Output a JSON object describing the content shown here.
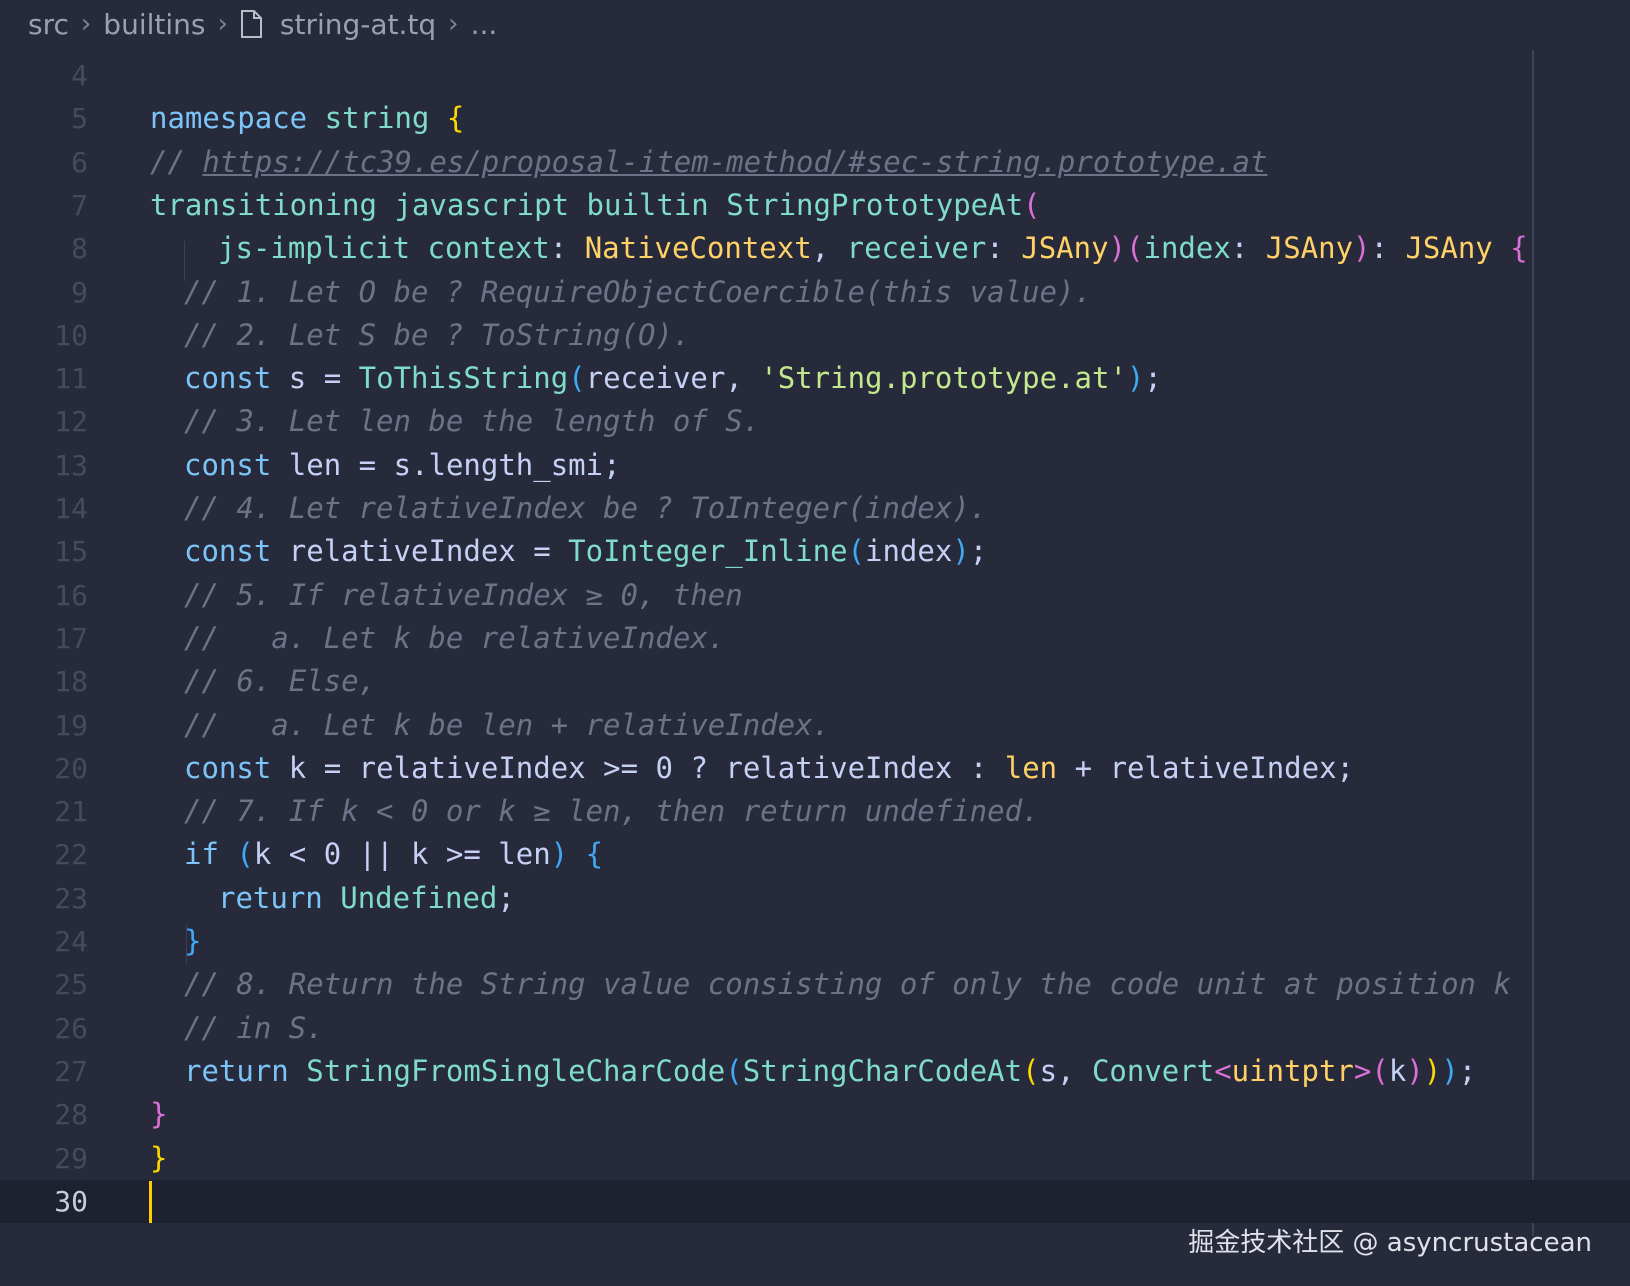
{
  "breadcrumb": {
    "items": [
      "src",
      "builtins",
      "string-at.tq",
      "..."
    ],
    "file_icon": "file-icon"
  },
  "editor": {
    "current_line": 30,
    "line_numbers": [
      "4",
      "5",
      "6",
      "7",
      "8",
      "9",
      "10",
      "11",
      "12",
      "13",
      "14",
      "15",
      "16",
      "17",
      "18",
      "19",
      "20",
      "21",
      "22",
      "23",
      "24",
      "25",
      "26",
      "27",
      "28",
      "29",
      "30"
    ],
    "lines": {
      "l5": {
        "namespace": "namespace",
        "name": "string",
        "brace": "{"
      },
      "l6": {
        "slashes": "// ",
        "url": "https://tc39.es/proposal-item-method/#sec-string.prototype.at"
      },
      "l7": {
        "transitioning": "transitioning",
        "javascript": "javascript",
        "builtin": "builtin",
        "fname": "StringPrototypeAt",
        "paren": "("
      },
      "l8": {
        "implicit": "js-implicit",
        "context": "context",
        "colon1": ":",
        "ctxtype": "NativeContext",
        "comma1": ",",
        "receiver": "receiver",
        "colon2": ":",
        "rtype": "JSAny",
        "close1": ")",
        "open2": "(",
        "index": "index",
        "colon3": ":",
        "itype": "JSAny",
        "close2": ")",
        "colon4": ":",
        "rettype": "JSAny",
        "brace": "{"
      },
      "l9": "// 1. Let O be ? RequireObjectCoercible(this value).",
      "l10": "// 2. Let S be ? ToString(O).",
      "l11": {
        "const": "const",
        "var": "s",
        "eq": "=",
        "fn": "ToThisString",
        "open": "(",
        "arg": "receiver",
        "comma": ",",
        "str": "'String.prototype.at'",
        "close": ")",
        "semi": ";"
      },
      "l12": "// 3. Let len be the length of S.",
      "l13": {
        "const": "const",
        "var": "len",
        "eq": "=",
        "expr": "s.length_smi",
        "semi": ";"
      },
      "l14": "// 4. Let relativeIndex be ? ToInteger(index).",
      "l15": {
        "const": "const",
        "var": "relativeIndex",
        "eq": "=",
        "fn": "ToInteger_Inline",
        "open": "(",
        "arg": "index",
        "close": ")",
        "semi": ";"
      },
      "l16": "// 5. If relativeIndex ≥ 0, then",
      "l17": "//   a. Let k be relativeIndex.",
      "l18": "// 6. Else,",
      "l19": "//   a. Let k be len + relativeIndex.",
      "l20": {
        "const": "const",
        "var": "k",
        "eq": "=",
        "a": "relativeIndex",
        "op1": ">=",
        "zero": "0",
        "q": "?",
        "b": "relativeIndex",
        "colon": ":",
        "len": "len",
        "plus": "+",
        "c": "relativeIndex",
        "semi": ";"
      },
      "l21": "// 7. If k < 0 or k ≥ len, then return undefined.",
      "l22": {
        "if": "if",
        "open": "(",
        "cond": "k < 0 || k >= len",
        "close": ")",
        "brace": "{"
      },
      "l23": {
        "return": "return",
        "value": "Undefined",
        "semi": ";"
      },
      "l24": {
        "brace": "}"
      },
      "l25": "// 8. Return the String value consisting of only the code unit at position k",
      "l26": "// in S.",
      "l27": {
        "return": "return",
        "fn1": "StringFromSingleCharCode",
        "o1": "(",
        "fn2": "StringCharCodeAt",
        "o2": "(",
        "s": "s",
        "comma": ",",
        "conv": "Convert",
        "lt": "<",
        "type": "uintptr",
        "gt": ">",
        "o3": "(",
        "k": "k",
        "c3": ")",
        "c2": ")",
        "c1": ")",
        "semi": ";"
      },
      "l28": {
        "brace": "}"
      },
      "l29": {
        "brace": "}"
      }
    }
  },
  "watermark": "掘金技术社区 @ asyncrustacean",
  "colors": {
    "background": "#262a3a",
    "keyword": "#7cc4f8",
    "type": "#7fdbca",
    "string": "#c3e88d",
    "comment": "#6c7389",
    "bracket_gold": "#ffd700",
    "bracket_pink": "#da70d6",
    "bracket_blue": "#3fa9f5",
    "cursor": "#ffcc00"
  }
}
